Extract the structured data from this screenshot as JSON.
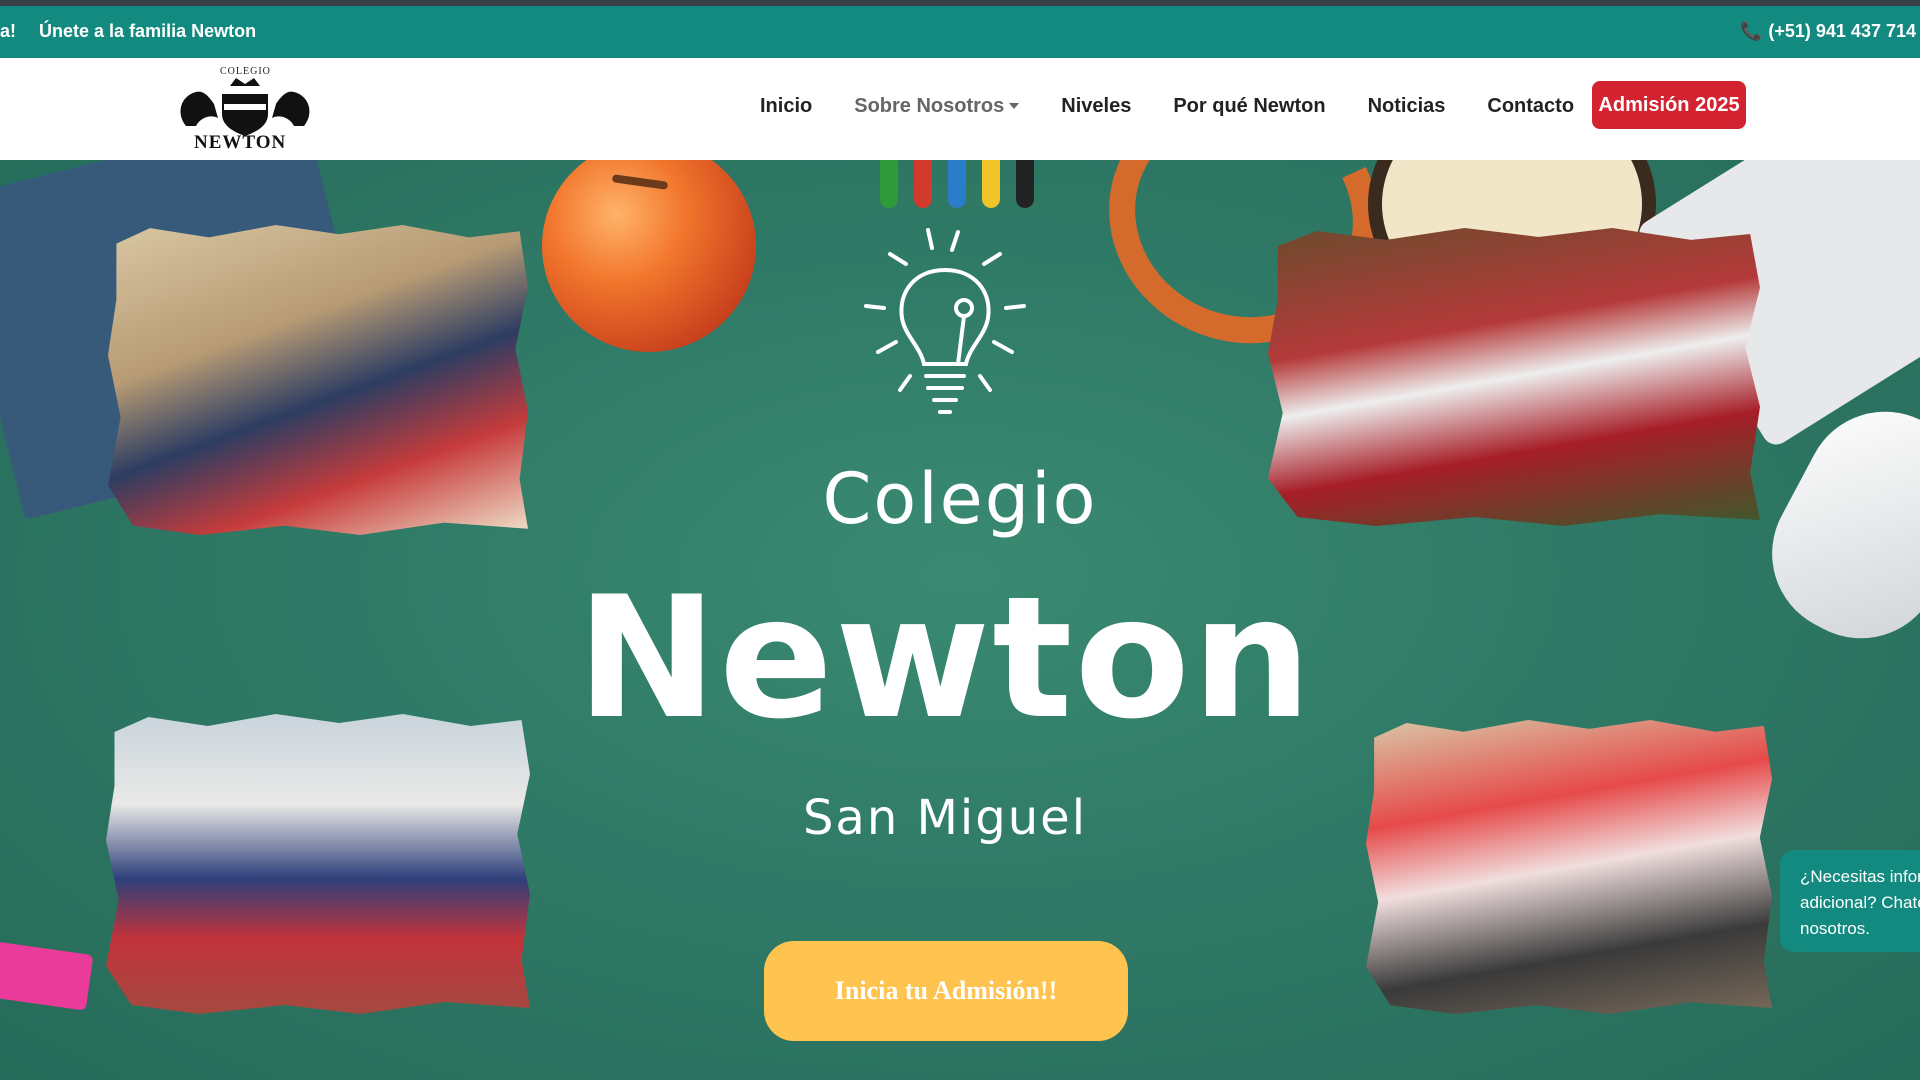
{
  "topbar": {
    "marquee_prefix": "a!",
    "marquee_text": "Únete a la familia Newton",
    "phone": "(+51) 941 437 714",
    "phone_icon": "phone-icon"
  },
  "logo": {
    "small_text": "COLEGIO",
    "word": "NEWTON"
  },
  "nav": {
    "items": [
      {
        "label": "Inicio"
      },
      {
        "label": "Sobre Nosotros"
      },
      {
        "label": "Niveles"
      },
      {
        "label": "Por qué Newton"
      },
      {
        "label": "Noticias"
      },
      {
        "label": "Contacto"
      }
    ],
    "admission_button": "Admisión 2025"
  },
  "hero": {
    "title_line1": "Colegio",
    "title_line2": "Newton",
    "title_line3": "San Miguel",
    "cta_label": "Inicia tu Admisión!!",
    "bulb_icon": "lightbulb-icon"
  },
  "chat": {
    "line1": "¿Necesitas infor",
    "line2": "adicional? Chate",
    "line3": "nosotros."
  },
  "colors": {
    "topbar": "#138a80",
    "admission": "#d32230",
    "cta": "#ffc34f",
    "hero_bg": "#2f7a66"
  }
}
